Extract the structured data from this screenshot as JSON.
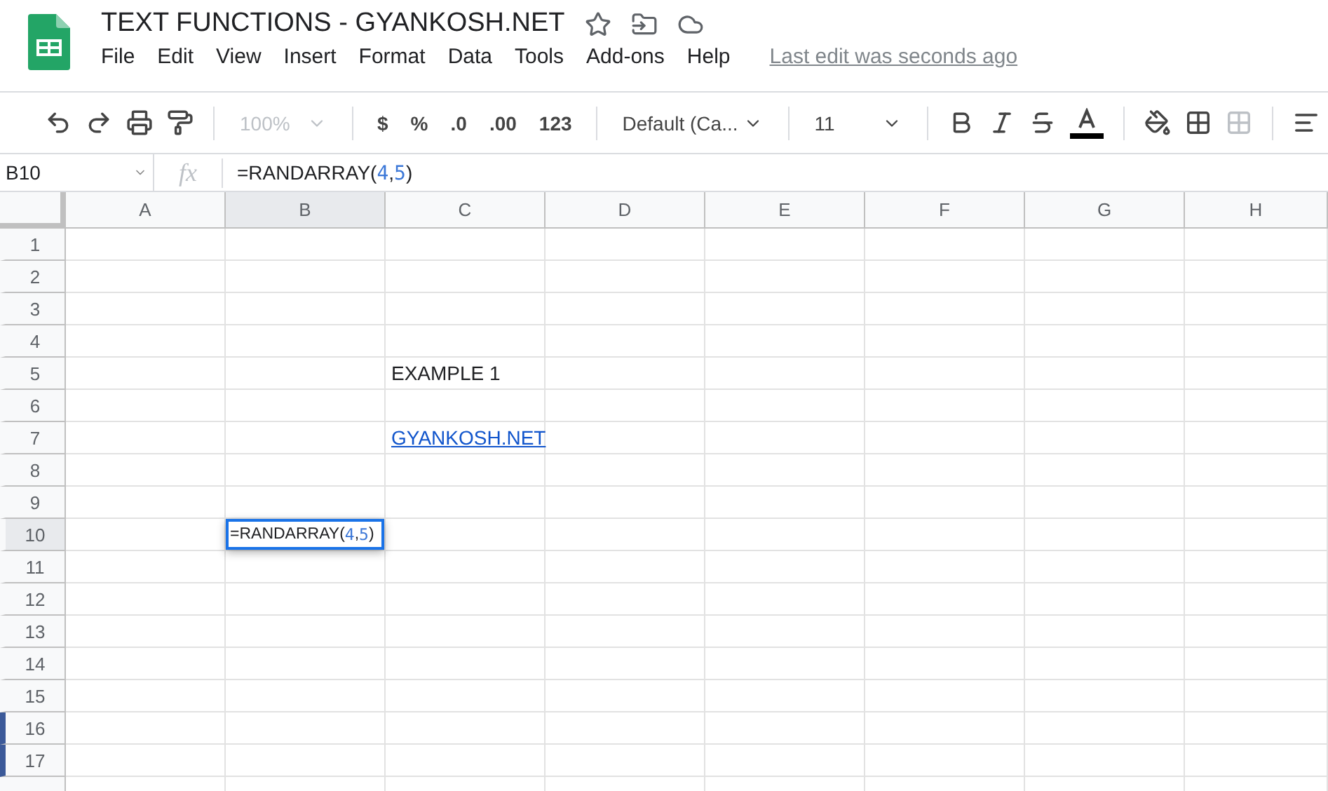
{
  "document": {
    "title": "TEXT FUNCTIONS - GYANKOSH.NET",
    "last_edit": "Last edit was seconds ago"
  },
  "menu": [
    "File",
    "Edit",
    "View",
    "Insert",
    "Format",
    "Data",
    "Tools",
    "Add-ons",
    "Help"
  ],
  "toolbar": {
    "zoom": {
      "value": "100%",
      "disabled": true
    },
    "format_buttons": [
      ".0",
      ".00",
      "123"
    ],
    "currency": "$",
    "percent": "%",
    "font": {
      "value": "Default (Ca..."
    },
    "font_size": {
      "value": "11"
    },
    "merge": {
      "disabled": true
    }
  },
  "formula_bar": {
    "cell_ref": "B10",
    "fx": "fx",
    "parts": [
      {
        "text": "=RANDARRAY(",
        "kind": "plain"
      },
      {
        "text": "4",
        "kind": "number"
      },
      {
        "text": ",",
        "kind": "plain"
      },
      {
        "text": "5",
        "kind": "number"
      },
      {
        "text": ")",
        "kind": "plain"
      }
    ]
  },
  "columns": [
    {
      "label": "A",
      "selected": false
    },
    {
      "label": "B",
      "selected": true
    },
    {
      "label": "C",
      "selected": false
    },
    {
      "label": "D",
      "selected": false
    },
    {
      "label": "E",
      "selected": false
    },
    {
      "label": "F",
      "selected": false
    },
    {
      "label": "G",
      "selected": false
    },
    {
      "label": "H",
      "selected": false
    }
  ],
  "rows": [
    {
      "label": "1",
      "selected": false,
      "marked": false,
      "cells": [
        {
          "kind": "empty"
        },
        {
          "kind": "empty"
        },
        {
          "kind": "empty"
        },
        {
          "kind": "empty"
        },
        {
          "kind": "empty"
        },
        {
          "kind": "empty"
        },
        {
          "kind": "empty"
        },
        {
          "kind": "empty"
        }
      ]
    },
    {
      "label": "2",
      "selected": false,
      "marked": false,
      "cells": [
        {
          "kind": "empty"
        },
        {
          "kind": "empty"
        },
        {
          "kind": "empty"
        },
        {
          "kind": "empty"
        },
        {
          "kind": "empty"
        },
        {
          "kind": "empty"
        },
        {
          "kind": "empty"
        },
        {
          "kind": "empty"
        }
      ]
    },
    {
      "label": "3",
      "selected": false,
      "marked": false,
      "cells": [
        {
          "kind": "empty"
        },
        {
          "kind": "empty"
        },
        {
          "kind": "empty"
        },
        {
          "kind": "empty"
        },
        {
          "kind": "empty"
        },
        {
          "kind": "empty"
        },
        {
          "kind": "empty"
        },
        {
          "kind": "empty"
        }
      ]
    },
    {
      "label": "4",
      "selected": false,
      "marked": false,
      "cells": [
        {
          "kind": "empty"
        },
        {
          "kind": "empty"
        },
        {
          "kind": "empty"
        },
        {
          "kind": "empty"
        },
        {
          "kind": "empty"
        },
        {
          "kind": "empty"
        },
        {
          "kind": "empty"
        },
        {
          "kind": "empty"
        }
      ]
    },
    {
      "label": "5",
      "selected": false,
      "marked": false,
      "cells": [
        {
          "kind": "empty"
        },
        {
          "kind": "empty"
        },
        {
          "kind": "text",
          "text": "EXAMPLE 1"
        },
        {
          "kind": "empty"
        },
        {
          "kind": "empty"
        },
        {
          "kind": "empty"
        },
        {
          "kind": "empty"
        },
        {
          "kind": "empty"
        }
      ]
    },
    {
      "label": "6",
      "selected": false,
      "marked": false,
      "cells": [
        {
          "kind": "empty"
        },
        {
          "kind": "empty"
        },
        {
          "kind": "empty"
        },
        {
          "kind": "empty"
        },
        {
          "kind": "empty"
        },
        {
          "kind": "empty"
        },
        {
          "kind": "empty"
        },
        {
          "kind": "empty"
        }
      ]
    },
    {
      "label": "7",
      "selected": false,
      "marked": false,
      "cells": [
        {
          "kind": "empty"
        },
        {
          "kind": "empty"
        },
        {
          "kind": "link",
          "text": "GYANKOSH.NET"
        },
        {
          "kind": "empty"
        },
        {
          "kind": "empty"
        },
        {
          "kind": "empty"
        },
        {
          "kind": "empty"
        },
        {
          "kind": "empty"
        }
      ]
    },
    {
      "label": "8",
      "selected": false,
      "marked": false,
      "cells": [
        {
          "kind": "empty"
        },
        {
          "kind": "empty"
        },
        {
          "kind": "empty"
        },
        {
          "kind": "empty"
        },
        {
          "kind": "empty"
        },
        {
          "kind": "empty"
        },
        {
          "kind": "empty"
        },
        {
          "kind": "empty"
        }
      ]
    },
    {
      "label": "9",
      "selected": false,
      "marked": false,
      "cells": [
        {
          "kind": "empty"
        },
        {
          "kind": "empty"
        },
        {
          "kind": "empty"
        },
        {
          "kind": "empty"
        },
        {
          "kind": "empty"
        },
        {
          "kind": "empty"
        },
        {
          "kind": "empty"
        },
        {
          "kind": "empty"
        }
      ]
    },
    {
      "label": "10",
      "selected": true,
      "marked": false,
      "cells": [
        {
          "kind": "empty"
        },
        {
          "kind": "formula",
          "parts": [
            {
              "text": "=RANDARRAY(",
              "kind": "plain"
            },
            {
              "text": "4",
              "kind": "number"
            },
            {
              "text": ",",
              "kind": "plain"
            },
            {
              "text": "5",
              "kind": "number"
            },
            {
              "text": ")",
              "kind": "plain"
            }
          ]
        },
        {
          "kind": "empty"
        },
        {
          "kind": "empty"
        },
        {
          "kind": "empty"
        },
        {
          "kind": "empty"
        },
        {
          "kind": "empty"
        },
        {
          "kind": "empty"
        }
      ]
    },
    {
      "label": "11",
      "selected": false,
      "marked": false,
      "cells": [
        {
          "kind": "empty"
        },
        {
          "kind": "empty"
        },
        {
          "kind": "empty"
        },
        {
          "kind": "empty"
        },
        {
          "kind": "empty"
        },
        {
          "kind": "empty"
        },
        {
          "kind": "empty"
        },
        {
          "kind": "empty"
        }
      ]
    },
    {
      "label": "12",
      "selected": false,
      "marked": false,
      "cells": [
        {
          "kind": "empty"
        },
        {
          "kind": "empty"
        },
        {
          "kind": "empty"
        },
        {
          "kind": "empty"
        },
        {
          "kind": "empty"
        },
        {
          "kind": "empty"
        },
        {
          "kind": "empty"
        },
        {
          "kind": "empty"
        }
      ]
    },
    {
      "label": "13",
      "selected": false,
      "marked": false,
      "cells": [
        {
          "kind": "empty"
        },
        {
          "kind": "empty"
        },
        {
          "kind": "empty"
        },
        {
          "kind": "empty"
        },
        {
          "kind": "empty"
        },
        {
          "kind": "empty"
        },
        {
          "kind": "empty"
        },
        {
          "kind": "empty"
        }
      ]
    },
    {
      "label": "14",
      "selected": false,
      "marked": false,
      "cells": [
        {
          "kind": "empty"
        },
        {
          "kind": "empty"
        },
        {
          "kind": "empty"
        },
        {
          "kind": "empty"
        },
        {
          "kind": "empty"
        },
        {
          "kind": "empty"
        },
        {
          "kind": "empty"
        },
        {
          "kind": "empty"
        }
      ]
    },
    {
      "label": "15",
      "selected": false,
      "marked": false,
      "cells": [
        {
          "kind": "empty"
        },
        {
          "kind": "empty"
        },
        {
          "kind": "empty"
        },
        {
          "kind": "empty"
        },
        {
          "kind": "empty"
        },
        {
          "kind": "empty"
        },
        {
          "kind": "empty"
        },
        {
          "kind": "empty"
        }
      ]
    },
    {
      "label": "16",
      "selected": false,
      "marked": true,
      "cells": [
        {
          "kind": "empty"
        },
        {
          "kind": "empty"
        },
        {
          "kind": "empty"
        },
        {
          "kind": "empty"
        },
        {
          "kind": "empty"
        },
        {
          "kind": "empty"
        },
        {
          "kind": "empty"
        },
        {
          "kind": "empty"
        }
      ]
    },
    {
      "label": "17",
      "selected": false,
      "marked": true,
      "cells": [
        {
          "kind": "empty"
        },
        {
          "kind": "empty"
        },
        {
          "kind": "empty"
        },
        {
          "kind": "empty"
        },
        {
          "kind": "empty"
        },
        {
          "kind": "empty"
        },
        {
          "kind": "empty"
        },
        {
          "kind": "empty"
        }
      ]
    }
  ]
}
